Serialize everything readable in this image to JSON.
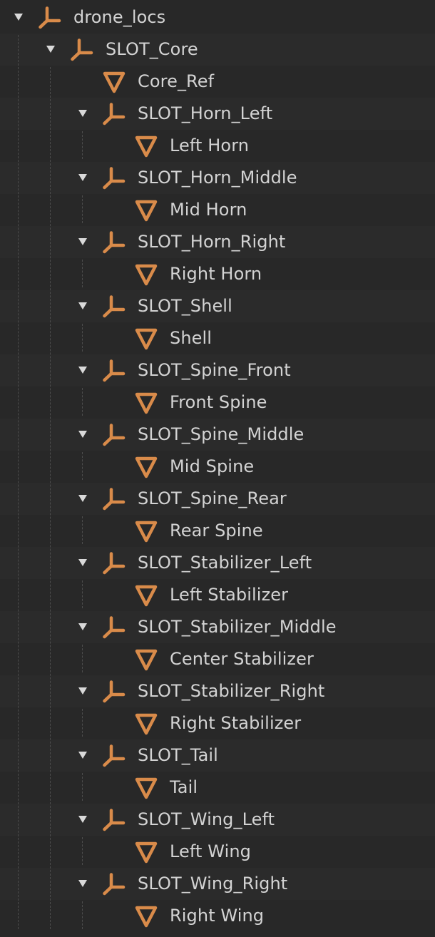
{
  "outliner": {
    "root": {
      "label": "drone_locs",
      "icon": "empty-axes-icon",
      "expanded": true,
      "children": [
        {
          "label": "SLOT_Core",
          "icon": "empty-axes-icon",
          "expanded": true,
          "children": [
            {
              "label": "Core_Ref",
              "icon": "mesh-triangle-icon"
            },
            {
              "label": "SLOT_Horn_Left",
              "icon": "empty-axes-icon",
              "expanded": true,
              "children": [
                {
                  "label": "Left Horn",
                  "icon": "mesh-triangle-icon"
                }
              ]
            },
            {
              "label": "SLOT_Horn_Middle",
              "icon": "empty-axes-icon",
              "expanded": true,
              "children": [
                {
                  "label": "Mid Horn",
                  "icon": "mesh-triangle-icon"
                }
              ]
            },
            {
              "label": "SLOT_Horn_Right",
              "icon": "empty-axes-icon",
              "expanded": true,
              "children": [
                {
                  "label": "Right Horn",
                  "icon": "mesh-triangle-icon"
                }
              ]
            },
            {
              "label": "SLOT_Shell",
              "icon": "empty-axes-icon",
              "expanded": true,
              "children": [
                {
                  "label": "Shell",
                  "icon": "mesh-triangle-icon"
                }
              ]
            },
            {
              "label": "SLOT_Spine_Front",
              "icon": "empty-axes-icon",
              "expanded": true,
              "children": [
                {
                  "label": "Front Spine",
                  "icon": "mesh-triangle-icon"
                }
              ]
            },
            {
              "label": "SLOT_Spine_Middle",
              "icon": "empty-axes-icon",
              "expanded": true,
              "children": [
                {
                  "label": "Mid Spine",
                  "icon": "mesh-triangle-icon"
                }
              ]
            },
            {
              "label": "SLOT_Spine_Rear",
              "icon": "empty-axes-icon",
              "expanded": true,
              "children": [
                {
                  "label": "Rear Spine",
                  "icon": "mesh-triangle-icon"
                }
              ]
            },
            {
              "label": "SLOT_Stabilizer_Left",
              "icon": "empty-axes-icon",
              "expanded": true,
              "children": [
                {
                  "label": "Left Stabilizer",
                  "icon": "mesh-triangle-icon"
                }
              ]
            },
            {
              "label": "SLOT_Stabilizer_Middle",
              "icon": "empty-axes-icon",
              "expanded": true,
              "children": [
                {
                  "label": "Center Stabilizer",
                  "icon": "mesh-triangle-icon"
                }
              ]
            },
            {
              "label": "SLOT_Stabilizer_Right",
              "icon": "empty-axes-icon",
              "expanded": true,
              "children": [
                {
                  "label": "Right Stabilizer",
                  "icon": "mesh-triangle-icon"
                }
              ]
            },
            {
              "label": "SLOT_Tail",
              "icon": "empty-axes-icon",
              "expanded": true,
              "children": [
                {
                  "label": "Tail",
                  "icon": "mesh-triangle-icon"
                }
              ]
            },
            {
              "label": "SLOT_Wing_Left",
              "icon": "empty-axes-icon",
              "expanded": true,
              "children": [
                {
                  "label": "Left Wing",
                  "icon": "mesh-triangle-icon"
                }
              ]
            },
            {
              "label": "SLOT_Wing_Right",
              "icon": "empty-axes-icon",
              "expanded": true,
              "children": [
                {
                  "label": "Right Wing",
                  "icon": "mesh-triangle-icon"
                }
              ]
            }
          ]
        }
      ]
    }
  },
  "colors": {
    "background": "#282828",
    "text": "#d3d3d3",
    "icon_orange": "#d98b4a",
    "expand_arrow": "#d9d9d9",
    "guide_line": "#4d4d4d"
  }
}
